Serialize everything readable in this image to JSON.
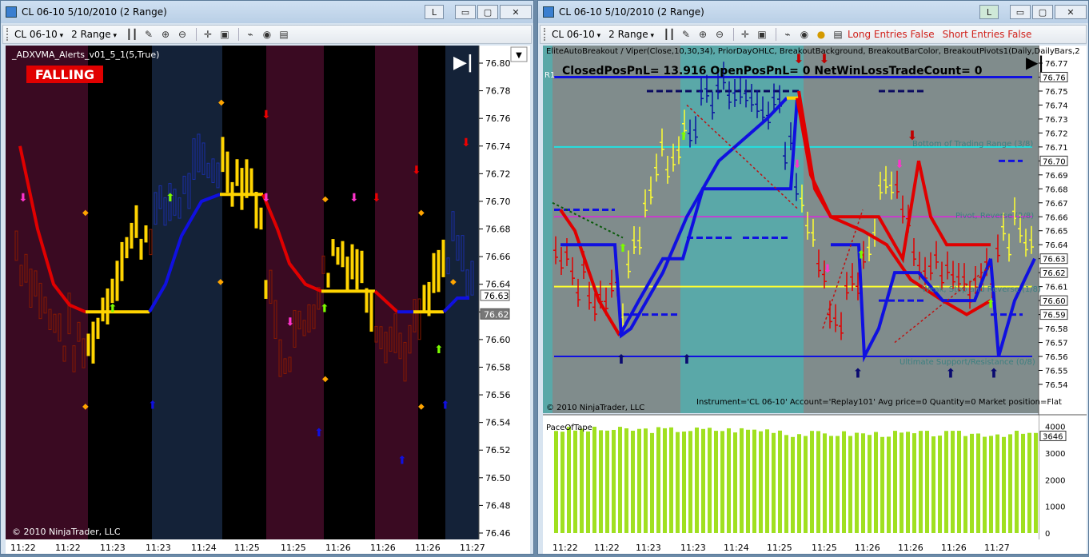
{
  "left_window": {
    "title": "CL 06-10  5/10/2010 (2 Range)",
    "buttons": {
      "l": "L",
      "minimize": "▭",
      "maximize": "▢",
      "close": "✕"
    },
    "toolbar": {
      "instrument": "CL 06-10",
      "period": "2 Range"
    },
    "indicator_label": "_ADXVMA_Alerts_v01_5_1(5,True)",
    "status_badge": "FALLING",
    "copyright": "© 2010 NinjaTrader, LLC",
    "price_ticks": [
      "76.80",
      "76.78",
      "76.76",
      "76.74",
      "76.72",
      "76.70",
      "76.68",
      "76.66",
      "76.64",
      "76.62",
      "76.60",
      "76.58",
      "76.56",
      "76.54",
      "76.52",
      "76.50",
      "76.48",
      "76.46"
    ],
    "price_markers": [
      "76.63",
      "76.62"
    ],
    "time_ticks": [
      "11:22",
      "11:22",
      "11:23",
      "11:23",
      "11:24",
      "11:25",
      "11:25",
      "11:26",
      "11:26",
      "11:26",
      "11:27"
    ]
  },
  "right_window": {
    "title": "CL 06-10  5/10/2010 (2 Range)",
    "buttons": {
      "l": "L",
      "minimize": "▭",
      "maximize": "▢",
      "close": "✕"
    },
    "toolbar": {
      "instrument": "CL 06-10",
      "period": "2 Range",
      "long_entries": "Long Entries False",
      "short_entries": "Short Entries False"
    },
    "indicator_label": "EliteAutoBreakout / Viper(Close,10,30,34), PriorDayOHLC, BreakoutBackground, BreakoutBarColor, BreakoutPivots1(Daily,DailyBars,2",
    "pnl_text": "ClosedPosPnL= 13.916  OpenPosPnL= 0  NetWinLossTradeCount= 0",
    "r1_label": "R1",
    "level_labels": {
      "bottom_range": "Bottom of Trading Range (3/8)",
      "pivot": "Pivot, Reverse (2/8)",
      "weak": "Weak, Stop and Reverse (1/8)",
      "ultimate": "Ultimate Support/Resistance (0/8)"
    },
    "copyright": "© 2010 NinjaTrader, LLC",
    "account_line": "Instrument='CL 06-10' Account='Replay101' Avg price=0 Quantity=0 Market position=Flat",
    "price_ticks": [
      "76.77",
      "76.76",
      "76.75",
      "76.74",
      "76.73",
      "76.72",
      "76.71",
      "76.70",
      "76.69",
      "76.68",
      "76.67",
      "76.66",
      "76.65",
      "76.64",
      "76.63",
      "76.62",
      "76.61",
      "76.60",
      "76.59",
      "76.58",
      "76.57",
      "76.56",
      "76.55",
      "76.54"
    ],
    "price_markers": [
      "76.76",
      "76.70",
      "76.63",
      "76.62",
      "76.60",
      "76.59"
    ],
    "lower_panel_label": "PaceOfTape",
    "volume_ticks": [
      "4000",
      "3000",
      "2000",
      "1000",
      "0"
    ],
    "volume_marker": "3646",
    "time_ticks": [
      "11:22",
      "11:22",
      "11:23",
      "11:23",
      "11:24",
      "11:25",
      "11:25",
      "11:26",
      "11:26",
      "11:26",
      "11:27"
    ]
  },
  "colors": {
    "rising": "#1010e0",
    "falling": "#e00000",
    "neutral": "#ffd400",
    "band_red": "#3a0a22",
    "band_blue": "#142238"
  }
}
